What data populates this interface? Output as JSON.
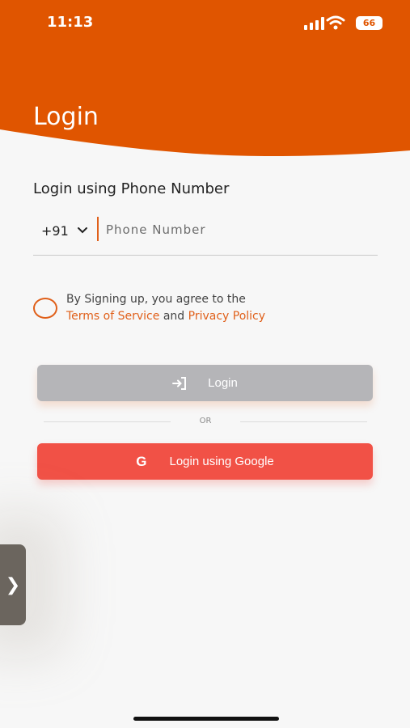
{
  "status_bar": {
    "time": "11:13",
    "battery": "66",
    "icons": [
      "signal-icon",
      "wifi-icon",
      "battery-icon"
    ]
  },
  "header": {
    "title": "Login",
    "color": "#e05500"
  },
  "form": {
    "section_title": "Login using Phone Number",
    "country_code": "+91",
    "phone_placeholder": "Phone Number",
    "phone_value": ""
  },
  "agreement": {
    "prefix": "By Signing up, you agree to the",
    "terms": "Terms of Service",
    "and": "and",
    "privacy": "Privacy Policy",
    "checked": false
  },
  "buttons": {
    "login_label": "Login",
    "or_label": "OR",
    "google_label": "Login using Google",
    "google_icon": "G"
  },
  "side_tab": {
    "icon": "❯"
  },
  "colors": {
    "accent": "#e0601a",
    "login_disabled": "#b5b5b8",
    "google": "#f15146"
  }
}
